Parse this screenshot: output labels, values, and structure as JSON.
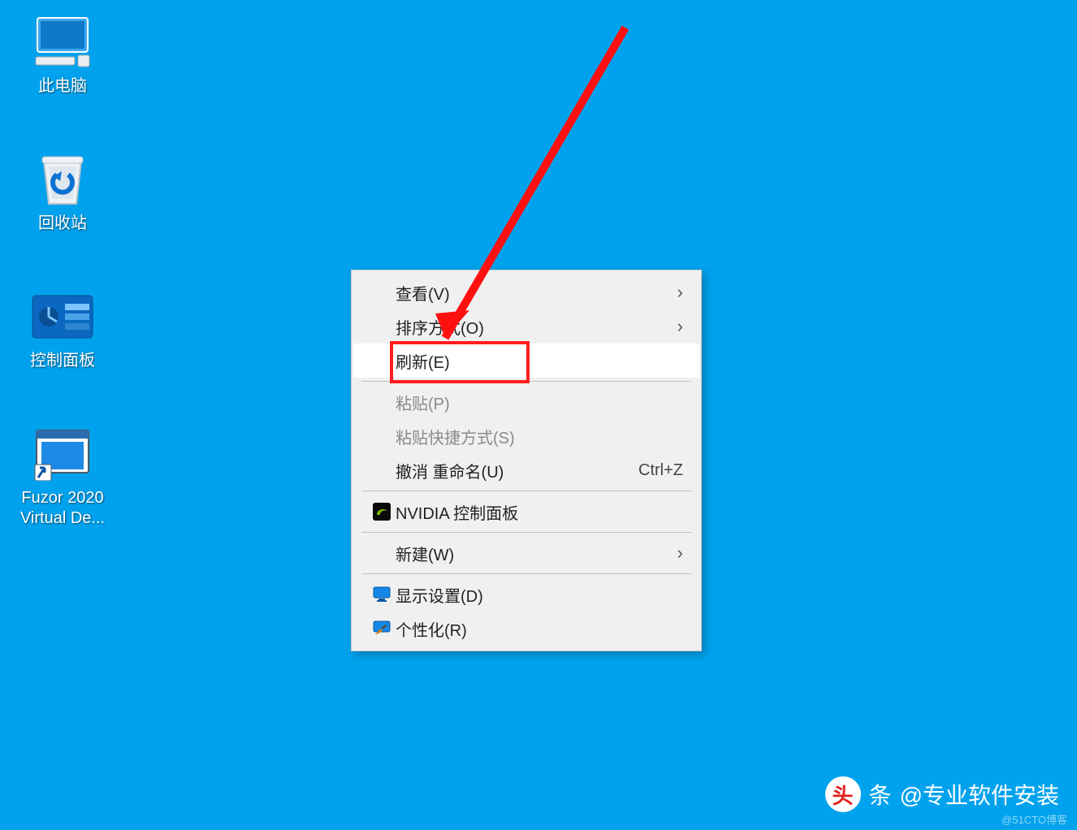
{
  "desktop": {
    "icons": [
      {
        "id": "this-pc",
        "label": "此电脑"
      },
      {
        "id": "recycle-bin",
        "label": "回收站"
      },
      {
        "id": "control-panel",
        "label": "控制面板"
      },
      {
        "id": "fuzor",
        "label": "Fuzor 2020 Virtual De..."
      }
    ]
  },
  "context_menu": {
    "items": [
      {
        "id": "view",
        "label": "查看(V)",
        "submenu": true
      },
      {
        "id": "sort",
        "label": "排序方式(O)",
        "submenu": true
      },
      {
        "id": "refresh",
        "label": "刷新(E)",
        "highlighted": true
      },
      {
        "sep": true
      },
      {
        "id": "paste",
        "label": "粘贴(P)",
        "disabled": true
      },
      {
        "id": "paste-sc",
        "label": "粘贴快捷方式(S)",
        "disabled": true
      },
      {
        "id": "undo",
        "label": "撤消 重命名(U)",
        "shortcut": "Ctrl+Z"
      },
      {
        "sep": true
      },
      {
        "id": "nvidia",
        "label": "NVIDIA 控制面板",
        "icon": "nvidia"
      },
      {
        "sep": true
      },
      {
        "id": "new",
        "label": "新建(W)",
        "submenu": true
      },
      {
        "sep": true
      },
      {
        "id": "display",
        "label": "显示设置(D)",
        "icon": "display"
      },
      {
        "id": "personal",
        "label": "个性化(R)",
        "icon": "personalize"
      }
    ]
  },
  "annotation": {
    "highlight_target": "refresh"
  },
  "footer": {
    "badge": "头",
    "prefix": "条",
    "account": "@专业软件安装"
  },
  "watermark": "@51CTO博客"
}
